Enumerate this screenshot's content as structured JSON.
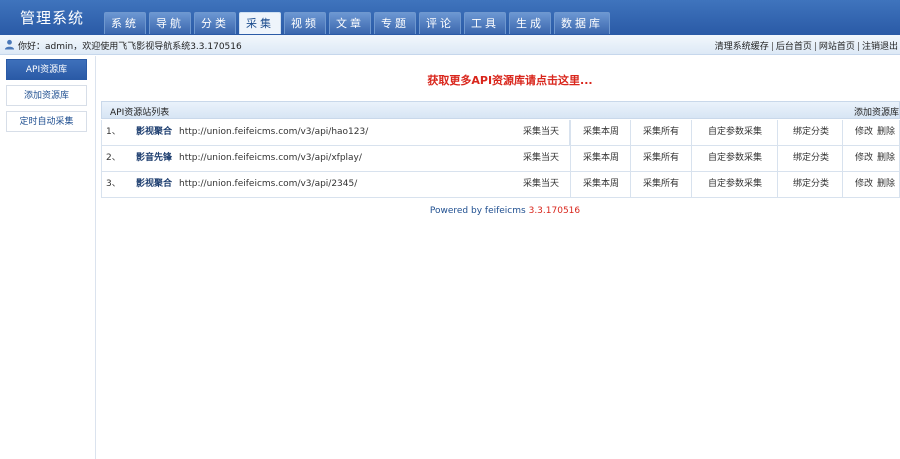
{
  "brand": "管理系统",
  "nav": [
    "系统",
    "导航",
    "分类",
    "采集",
    "视频",
    "文章",
    "专题",
    "评论",
    "工具",
    "生成",
    "数据库"
  ],
  "nav_active": 3,
  "welcome": "你好：admin，欢迎使用飞飞影视导航系统3.3.170516",
  "top_links": [
    "清理系统缓存",
    "后台首页",
    "网站首页",
    "注销退出"
  ],
  "sidebar": [
    "API资源库",
    "添加资源库",
    "定时自动采集"
  ],
  "promo": "获取更多API资源库请点击这里...",
  "list": {
    "title": "API资源站列表",
    "add": "添加资源库",
    "rows": [
      {
        "num": "1、",
        "name": "影视聚合",
        "url": "http://union.feifeicms.com/v3/api/hao123/"
      },
      {
        "num": "2、",
        "name": "影音先锋",
        "url": "http://union.feifeicms.com/v3/api/xfplay/"
      },
      {
        "num": "3、",
        "name": "影视聚合",
        "url": "http://union.feifeicms.com/v3/api/2345/"
      }
    ],
    "actions": {
      "today": "采集当天",
      "week": "采集本周",
      "all": "采集所有",
      "custom": "自定参数采集",
      "bind": "绑定分类",
      "edit": "修改",
      "delete": "删除"
    }
  },
  "footer": {
    "prefix": "Powered by feifeicms",
    "version": "3.3.170516"
  },
  "colors": {
    "header": "#2a5aa6",
    "promo": "#d9261c",
    "link": "#1f4f90"
  }
}
